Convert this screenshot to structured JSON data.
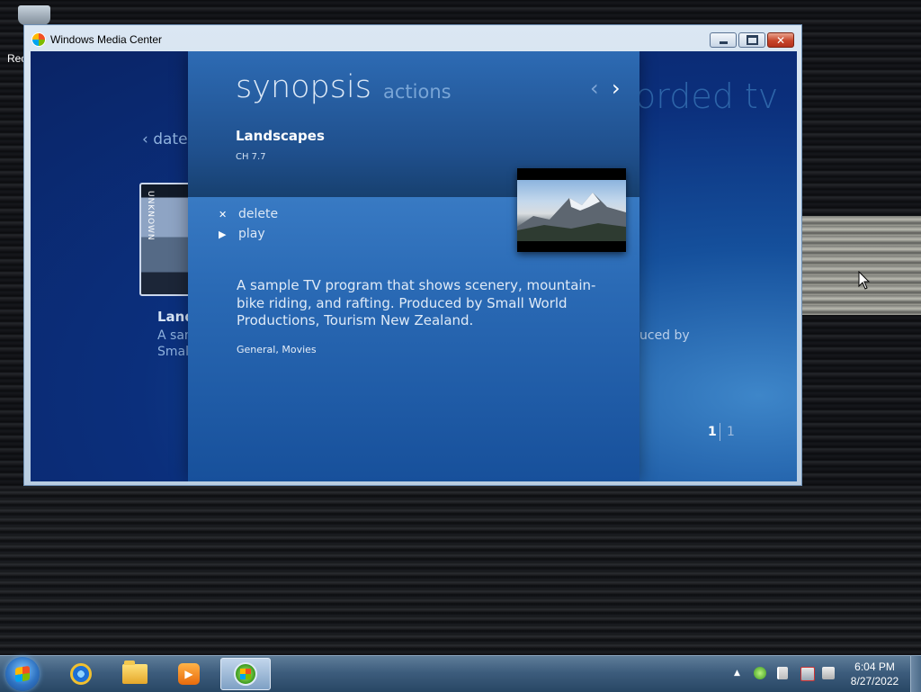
{
  "desktop": {
    "recycle_label": "Rec"
  },
  "window": {
    "title": "Windows Media Center",
    "controls": {
      "minimize": "",
      "maximize": "",
      "close": "✕"
    }
  },
  "background": {
    "page_title_fragment": "orded tv",
    "nav_label": "date",
    "thumb_label": "UNKNOWN",
    "program_title_fragment": "Land",
    "desc_line1_fragment": "A sam",
    "desc_line2_fragment": "Small",
    "right_desc_fragment": "uced by",
    "page_current": "1",
    "page_total": "1"
  },
  "panel": {
    "tabs": {
      "synopsis": "synopsis",
      "actions": "actions"
    },
    "nav": {
      "prev": "‹",
      "next": "›"
    },
    "program_title": "Landscapes",
    "channel": "CH 7.7",
    "actions": [
      {
        "symbol": "✕",
        "label": "delete"
      },
      {
        "symbol": "▶",
        "label": "play"
      }
    ],
    "description": "A sample TV program that shows scenery, mountain-bike riding, and rafting. Produced by Small World Productions, Tourism New Zealand.",
    "genre": "General, Movies"
  },
  "taskbar": {
    "start_icon": "windows-orb",
    "pinned": [
      "internet-explorer",
      "windows-explorer",
      "windows-media-player",
      "windows-media-center"
    ],
    "tray": {
      "show_hidden": "▲"
    },
    "clock": {
      "time": "6:04 PM",
      "date": "8/27/2022"
    }
  }
}
